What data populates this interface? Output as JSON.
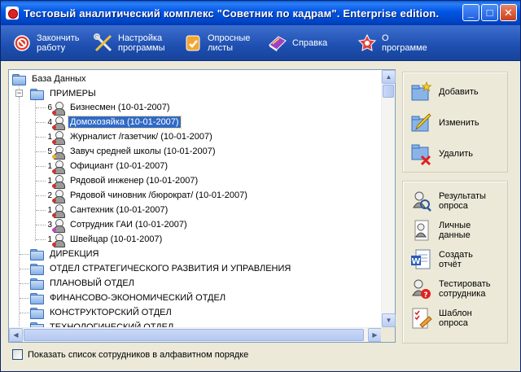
{
  "window": {
    "title": "Тестовый аналитический комплекс \"Советник по кадрам\". Enterprise edition.",
    "controls": {
      "minimize": "_",
      "maximize": "□",
      "close": "✕"
    }
  },
  "toolbar": {
    "buttons": [
      {
        "label": "Закончить\nработу",
        "icon": "stop-icon"
      },
      {
        "label": "Настройка\nпрограммы",
        "icon": "tools-icon"
      },
      {
        "label": "Опросные\nлисты",
        "icon": "sheets-icon"
      },
      {
        "label": "Справка",
        "icon": "help-book-icon"
      },
      {
        "label": "О\nпрограмме",
        "icon": "about-icon"
      }
    ]
  },
  "tree": {
    "root": "База Данных",
    "examples_folder": "ПРИМЕРЫ",
    "employees": [
      {
        "num": "6",
        "label": "Бизнесмен (10-01-2007)",
        "accent": "#d0302a"
      },
      {
        "num": "4",
        "label": "Домохозяйка (10-01-2007)",
        "accent": "#d0302a",
        "selected": true
      },
      {
        "num": "1",
        "label": "Журналист /газетчик/ (10-01-2007)",
        "accent": "#d0302a"
      },
      {
        "num": "5",
        "label": "Завуч средней школы (10-01-2007)",
        "accent": "#e6b020"
      },
      {
        "num": "1",
        "label": "Официант (10-01-2007)",
        "accent": "#d0302a"
      },
      {
        "num": "1",
        "label": "Рядовой инженер (10-01-2007)",
        "accent": "#d0302a"
      },
      {
        "num": "2",
        "label": "Рядовой чиновник /бюрократ/ (10-01-2007)",
        "accent": "#d0302a"
      },
      {
        "num": "1",
        "label": "Сантехник (10-01-2007)",
        "accent": "#d0302a"
      },
      {
        "num": "3",
        "label": "Сотрудник ГАИ (10-01-2007)",
        "accent": "#c040c0"
      },
      {
        "num": "1",
        "label": "Швейцар (10-01-2007)",
        "accent": "#d0302a"
      }
    ],
    "folders": [
      "ДИРЕКЦИЯ",
      "ОТДЕЛ СТРАТЕГИЧЕСКОГО РАЗВИТИЯ И УПРАВЛЕНИЯ",
      "ПЛАНОВЫЙ ОТДЕЛ",
      "ФИНАНСОВО-ЭКОНОМИЧЕСКИЙ ОТДЕЛ",
      "КОНСТРУКТОРСКИЙ ОТДЕЛ",
      "ТЕХНОЛОГИЧЕСКИЙ ОТДЕЛ"
    ]
  },
  "actions_top": [
    {
      "label": "Добавить",
      "icon": "add-folder-icon"
    },
    {
      "label": "Изменить",
      "icon": "edit-folder-icon"
    },
    {
      "label": "Удалить",
      "icon": "delete-folder-icon"
    }
  ],
  "actions_bottom": [
    {
      "label": "Результаты\nопроса",
      "icon": "survey-results-icon"
    },
    {
      "label": "Личные\nданные",
      "icon": "personal-data-icon"
    },
    {
      "label": "Создать\nотчёт",
      "icon": "word-report-icon"
    },
    {
      "label": "Тестировать\nсотрудника",
      "icon": "test-employee-icon"
    },
    {
      "label": "Шаблон\nопроса",
      "icon": "survey-template-icon"
    }
  ],
  "footer": {
    "alphabetical_label": "Показать список сотрудников в алфавитном порядке",
    "alphabetical_checked": false
  }
}
